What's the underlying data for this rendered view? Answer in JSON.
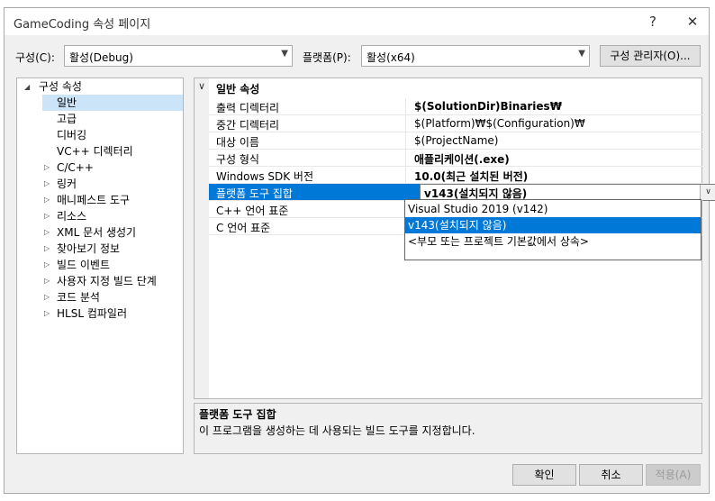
{
  "window": {
    "title": "GameCoding 속성 페이지",
    "help_glyph": "?",
    "close_glyph": "✕"
  },
  "toolbar": {
    "config_label": "구성(C):",
    "config_value": "활성(Debug)",
    "platform_label": "플랫폼(P):",
    "platform_value": "활성(x64)",
    "config_manager_button": "구성 관리자(O)..."
  },
  "tree": {
    "root": "구성 속성",
    "items": [
      {
        "label": "일반",
        "selected": true,
        "expandable": false
      },
      {
        "label": "고급",
        "expandable": false
      },
      {
        "label": "디버깅",
        "expandable": false
      },
      {
        "label": "VC++ 디렉터리",
        "expandable": false
      },
      {
        "label": "C/C++",
        "expandable": true
      },
      {
        "label": "링커",
        "expandable": true
      },
      {
        "label": "매니페스트 도구",
        "expandable": true
      },
      {
        "label": "리소스",
        "expandable": true
      },
      {
        "label": "XML 문서 생성기",
        "expandable": true
      },
      {
        "label": "찾아보기 정보",
        "expandable": true
      },
      {
        "label": "빌드 이벤트",
        "expandable": true
      },
      {
        "label": "사용자 지정 빌드 단계",
        "expandable": true
      },
      {
        "label": "코드 분석",
        "expandable": true
      },
      {
        "label": "HLSL 컴파일러",
        "expandable": true
      }
    ]
  },
  "grid": {
    "category": "일반 속성",
    "rows": [
      {
        "name": "출력 디렉터리",
        "value": "$(SolutionDir)Binaries₩",
        "bold": true
      },
      {
        "name": "중간 디렉터리",
        "value": "$(Platform)₩$(Configuration)₩",
        "bold": false
      },
      {
        "name": "대상 이름",
        "value": "$(ProjectName)",
        "bold": false
      },
      {
        "name": "구성 형식",
        "value": "애플리케이션(.exe)",
        "bold": true
      },
      {
        "name": "Windows SDK 버전",
        "value": "10.0(최근 설치된 버전)",
        "bold": true
      },
      {
        "name": "플랫폼 도구 집합",
        "value": "v143(설치되지 않음)",
        "bold": true,
        "selected": true
      },
      {
        "name": "C++ 언어 표준",
        "value": "",
        "bold": false
      },
      {
        "name": "C 언어 표준",
        "value": "",
        "bold": false
      }
    ]
  },
  "dropdown": {
    "options": [
      {
        "label": "Visual Studio 2019 (v142)",
        "selected": false
      },
      {
        "label": "v143(설치되지 않음)",
        "selected": true
      },
      {
        "label": "<부모 또는 프로젝트 기본값에서 상속>",
        "selected": false
      }
    ]
  },
  "description": {
    "title": "플랫폼 도구 집합",
    "text": "이 프로그램을 생성하는 데 사용되는 빌드 도구를 지정합니다."
  },
  "buttons": {
    "ok": "확인",
    "cancel": "취소",
    "apply": "적용(A)"
  },
  "colors": {
    "selection": "#0078d7",
    "tree_selection": "#cce4f7"
  }
}
